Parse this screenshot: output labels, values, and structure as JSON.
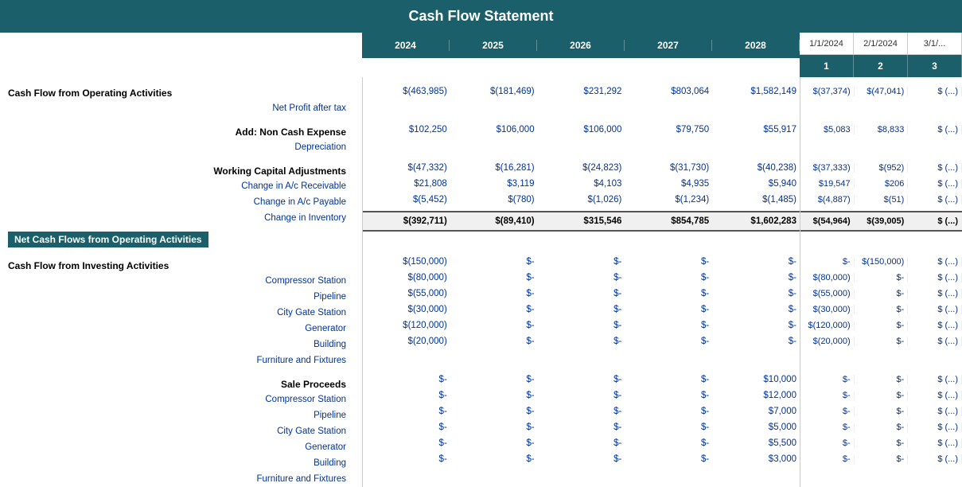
{
  "title": "Cash Flow Statement",
  "annual_headers": {
    "years": [
      "2024",
      "2025",
      "2026",
      "2027",
      "2028"
    ]
  },
  "monthly_headers": {
    "dates": [
      "1/1/2024",
      "2/1/2024",
      "3/1/..."
    ],
    "nums": [
      "1",
      "2",
      "3"
    ]
  },
  "sections": {
    "operating_header": "Cash Flow from Operating Activities",
    "net_profit_label": "Net Profit after tax",
    "non_cash_header": "Add: Non Cash Expense",
    "depreciation_label": "Depreciation",
    "working_capital_header": "Working Capital Adjustments",
    "change_ar_label": "Change in A/c Receivable",
    "change_ap_label": "Change in A/c Payable",
    "change_inv_label": "Change in Inventory",
    "net_cashflow_label": "Net Cash Flows from Operating Activities",
    "investing_header": "Cash Flow from Investing Activities",
    "compressor_label": "Compressor Station",
    "pipeline_label": "Pipeline",
    "citygate_label": "City Gate Station",
    "generator_label": "Generator",
    "building_label": "Building",
    "furniture_label": "Furniture and Fixtures",
    "sale_proceeds_header": "Sale Proceeds",
    "sp_compressor_label": "Compressor Station",
    "sp_pipeline_label": "Pipeline",
    "sp_citygate_label": "City Gate Station",
    "sp_generator_label": "Generator",
    "sp_building_label": "Building",
    "sp_furniture_label": "Furniture and Fixtures"
  },
  "annual_data": {
    "net_profit": [
      "(463,985)",
      "(181,469)",
      "231,292",
      "803,064",
      "1,582,149"
    ],
    "depreciation": [
      "102,250",
      "106,000",
      "106,000",
      "79,750",
      "55,917"
    ],
    "change_ar": [
      "(47,332)",
      "(16,281)",
      "(24,823)",
      "(31,730)",
      "(40,238)"
    ],
    "change_ap": [
      "21,808",
      "3,119",
      "4,103",
      "4,935",
      "5,940"
    ],
    "change_inv": [
      "(5,452)",
      "(780)",
      "(1,026)",
      "(1,234)",
      "(1,485)"
    ],
    "net_cashflow": [
      "(392,711)",
      "(89,410)",
      "315,546",
      "854,785",
      "1,602,283"
    ],
    "compressor": [
      "(150,000)",
      "-",
      "-",
      "-",
      "-"
    ],
    "pipeline": [
      "(80,000)",
      "-",
      "-",
      "-",
      "-"
    ],
    "citygate": [
      "(55,000)",
      "-",
      "-",
      "-",
      "-"
    ],
    "generator": [
      "(30,000)",
      "-",
      "-",
      "-",
      "-"
    ],
    "building": [
      "(120,000)",
      "-",
      "-",
      "-",
      "-"
    ],
    "furniture": [
      "(20,000)",
      "-",
      "-",
      "-",
      "-"
    ],
    "sp_compressor": [
      "-",
      "-",
      "-",
      "-",
      "10,000"
    ],
    "sp_pipeline": [
      "-",
      "-",
      "-",
      "-",
      "12,000"
    ],
    "sp_citygate": [
      "-",
      "-",
      "-",
      "-",
      "7,000"
    ],
    "sp_generator": [
      "-",
      "-",
      "-",
      "-",
      "5,000"
    ],
    "sp_building": [
      "-",
      "-",
      "-",
      "-",
      "5,500"
    ],
    "sp_furniture": [
      "-",
      "-",
      "-",
      "-",
      "3,000"
    ]
  },
  "monthly_data": {
    "net_profit": [
      "(37,374)",
      "(47,041)",
      "..."
    ],
    "depreciation": [
      "5,083",
      "8,833",
      "..."
    ],
    "change_ar": [
      "(37,333)",
      "(952)",
      "..."
    ],
    "change_ap": [
      "19,547",
      "206",
      "..."
    ],
    "change_inv": [
      "(4,887)",
      "(51)",
      "..."
    ],
    "net_cashflow": [
      "(54,964)",
      "(39,005)",
      "..."
    ],
    "compressor": [
      "-",
      "(150,000)",
      "..."
    ],
    "pipeline": [
      "(80,000)",
      "-",
      "..."
    ],
    "citygate": [
      "(55,000)",
      "-",
      "..."
    ],
    "generator": [
      "(30,000)",
      "-",
      "..."
    ],
    "building": [
      "(120,000)",
      "-",
      "..."
    ],
    "furniture": [
      "(20,000)",
      "-",
      "..."
    ],
    "sp_compressor": [
      "-",
      "-",
      "..."
    ],
    "sp_pipeline": [
      "-",
      "-",
      "..."
    ],
    "sp_citygate": [
      "-",
      "-",
      "..."
    ],
    "sp_generator": [
      "-",
      "-",
      "..."
    ],
    "sp_building": [
      "-",
      "-",
      "..."
    ],
    "sp_furniture": [
      "-",
      "-",
      "..."
    ]
  }
}
